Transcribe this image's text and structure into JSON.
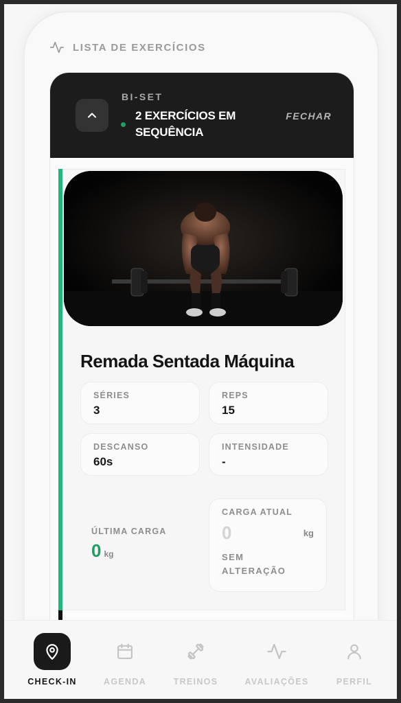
{
  "section": {
    "title": "LISTA DE EXERCÍCIOS",
    "icon": "activity-icon"
  },
  "group": {
    "type_label": "BI-SET",
    "description": "2 EXERCÍCIOS EM SEQUÊNCIA",
    "close_label": "FECHAR",
    "accent_color": "#22b57c"
  },
  "exercise": {
    "name": "Remada Sentada Máquina",
    "image": "weightlifter-deadlift-photo",
    "stats": [
      {
        "label": "SÉRIES",
        "value": "3"
      },
      {
        "label": "REPS",
        "value": "15"
      },
      {
        "label": "DESCANSO",
        "value": "60s"
      },
      {
        "label": "INTENSIDADE",
        "value": "-"
      }
    ],
    "last_load": {
      "label": "ÚLTIMA CARGA",
      "value": "0",
      "unit": "kg"
    },
    "current_load": {
      "label": "CARGA ATUAL",
      "placeholder": "0",
      "unit": "kg",
      "status": "SEM ALTERAÇÃO"
    }
  },
  "nav": {
    "items": [
      {
        "label": "CHECK-IN",
        "icon": "map-pin-icon",
        "active": true
      },
      {
        "label": "AGENDA",
        "icon": "calendar-icon",
        "active": false
      },
      {
        "label": "TREINOS",
        "icon": "dumbbell-icon",
        "active": false
      },
      {
        "label": "AVALIAÇÕES",
        "icon": "activity-icon",
        "active": false
      },
      {
        "label": "PERFIL",
        "icon": "user-icon",
        "active": false
      }
    ]
  }
}
